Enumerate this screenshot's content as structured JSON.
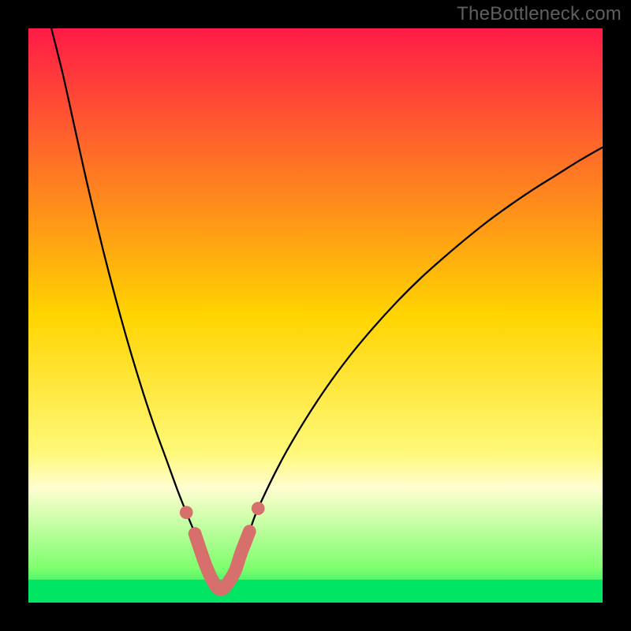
{
  "watermark": "TheBottleneck.com",
  "chart_data": {
    "type": "line",
    "title": "",
    "xlabel": "",
    "ylabel": "",
    "xlim": [
      0,
      100
    ],
    "ylim": [
      0,
      100
    ],
    "optimum_x": 33,
    "green_band": {
      "y_start": 0,
      "y_end": 4
    },
    "background_gradient": [
      {
        "offset": 0.0,
        "color": "#ff1b47"
      },
      {
        "offset": 0.5,
        "color": "#ffd400"
      },
      {
        "offset": 0.74,
        "color": "#fff97a"
      },
      {
        "offset": 0.8,
        "color": "#fffdd0"
      },
      {
        "offset": 0.94,
        "color": "#7fff6e"
      },
      {
        "offset": 1.0,
        "color": "#00e563"
      }
    ],
    "curve": {
      "name": "bottleneck",
      "x": [
        4,
        6,
        8,
        10,
        12,
        14,
        16,
        18,
        20,
        22,
        24,
        26,
        27.5,
        29,
        30,
        31,
        32,
        33,
        34,
        35,
        36,
        37,
        38.5,
        40,
        44,
        48,
        52,
        56,
        60,
        64,
        68,
        72,
        76,
        80,
        84,
        88,
        92,
        96,
        100
      ],
      "y": [
        100,
        92,
        83,
        74,
        65.5,
        57.5,
        50,
        43,
        36.5,
        30.5,
        25,
        19.5,
        15.7,
        12,
        9,
        6.2,
        4,
        2.5,
        2.5,
        3.8,
        5.5,
        8.5,
        12.4,
        16.4,
        24.6,
        31.5,
        37.6,
        43,
        47.8,
        52.2,
        56.2,
        59.8,
        63.2,
        66.4,
        69.3,
        72.0,
        74.5,
        77,
        79.3
      ]
    },
    "highlight_points": {
      "thick_segment_x": [
        29,
        30,
        31,
        32,
        33,
        34,
        35,
        36,
        37,
        38.5
      ],
      "thick_segment_y": [
        12,
        9,
        6.2,
        4,
        2.5,
        2.5,
        3.8,
        5.5,
        8.5,
        12.4
      ],
      "dots_x": [
        27.5,
        40
      ],
      "dots_y": [
        15.7,
        16.4
      ],
      "color": "#d76f6d"
    }
  },
  "colors": {
    "frame": "#000000",
    "curve": "#000000",
    "highlight": "#d76f6d",
    "watermark": "#5f5f5f"
  }
}
